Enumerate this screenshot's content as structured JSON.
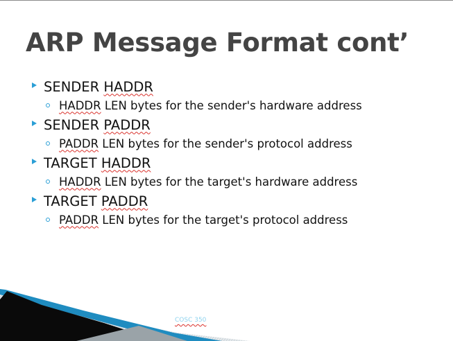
{
  "slide": {
    "title": "ARP Message Format cont’",
    "footer": "COSC 350",
    "bullets": [
      {
        "label_pre": "SENDER ",
        "label_word": "HADDR",
        "sub_word": "HADDR",
        "sub_rest": " LEN bytes for the sender's hardware address"
      },
      {
        "label_pre": "SENDER ",
        "label_word": "PADDR",
        "sub_word": "PADDR",
        "sub_rest": " LEN bytes for the sender's protocol address"
      },
      {
        "label_pre": "TARGET ",
        "label_word": "HADDR",
        "sub_word": "HADDR",
        "sub_rest": " LEN bytes for the target's hardware address"
      },
      {
        "label_pre": "TARGET ",
        "label_word": "PADDR",
        "sub_word": "PADDR",
        "sub_rest": " LEN bytes for the target's protocol address"
      }
    ]
  },
  "colors": {
    "title": "#444444",
    "text": "#111111",
    "bullet_accent": "#2b9fd6",
    "spell_underline": "#d9302a",
    "footer": "#8fd3ee"
  },
  "icons": {
    "level1_bullet": "triangle-bullet-icon",
    "level2_bullet": "circle-bullet-icon"
  }
}
